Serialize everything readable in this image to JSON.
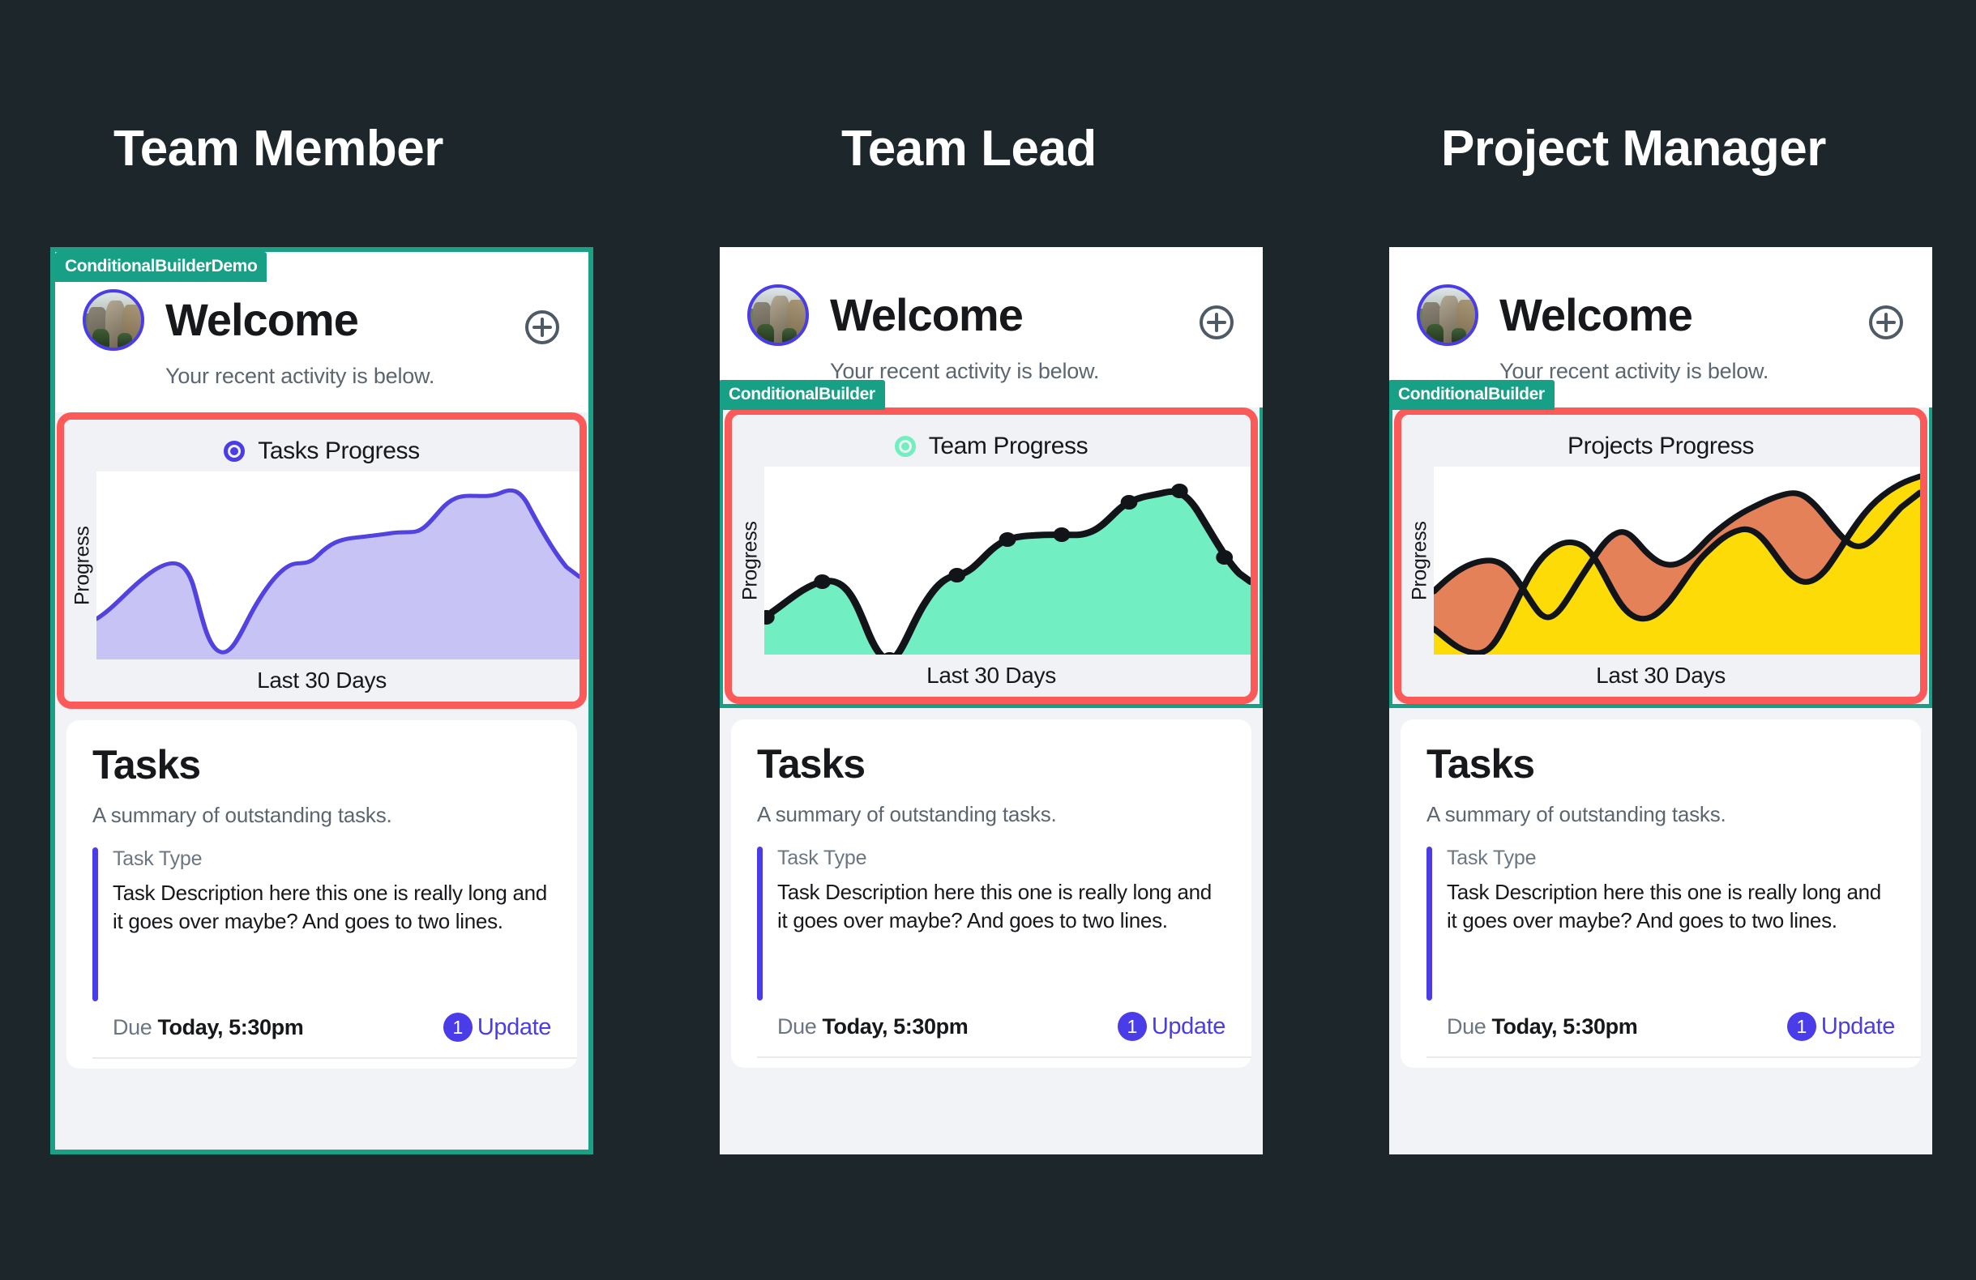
{
  "page": {
    "background_color": "#1d262b",
    "highlight_color": "#fb5a58",
    "teal_color": "#17a086",
    "accent_indigo": "#4a3ce8"
  },
  "columns": [
    {
      "heading": "Team Member",
      "builder_tag": "ConditionalBuilderDemo",
      "tag_position": "card-top",
      "card_outline": "teal-full",
      "welcome": {
        "title": "Welcome",
        "subtitle": "Your recent activity is below.",
        "avatar_icon": "avatar-photo",
        "add_icon": "plus-circle-icon"
      },
      "chart": {
        "title": "Tasks Progress",
        "has_radio": true,
        "radio_color": "#4a3ce8",
        "ylabel": "Progress",
        "xlabel": "Last 30 Days"
      },
      "tasks": {
        "title": "Tasks",
        "subtitle": "A summary of outstanding tasks.",
        "item": {
          "type": "Task Type",
          "description": "Task Description here this one is really long and it goes over maybe? And goes to two lines.",
          "due_label": "Due",
          "due_value": "Today, 5:30pm",
          "badge_count": "1",
          "update_label": "Update"
        }
      }
    },
    {
      "heading": "Team Lead",
      "builder_tag": "ConditionalBuilder",
      "tag_position": "chart-top",
      "card_outline": "teal-chart",
      "welcome": {
        "title": "Welcome",
        "subtitle": "Your recent activity is below.",
        "avatar_icon": "avatar-photo",
        "add_icon": "plus-circle-icon"
      },
      "chart": {
        "title": "Team Progress",
        "has_radio": true,
        "radio_color": "#71efc0",
        "ylabel": "Progress",
        "xlabel": "Last 30 Days"
      },
      "tasks": {
        "title": "Tasks",
        "subtitle": "A summary of outstanding tasks.",
        "item": {
          "type": "Task Type",
          "description": "Task Description here this one is really long and it goes over maybe? And goes to two lines.",
          "due_label": "Due",
          "due_value": "Today, 5:30pm",
          "badge_count": "1",
          "update_label": "Update"
        }
      }
    },
    {
      "heading": "Project Manager",
      "builder_tag": "ConditionalBuilder",
      "tag_position": "chart-top",
      "card_outline": "teal-chart",
      "welcome": {
        "title": "Welcome",
        "subtitle": "Your recent activity is below.",
        "avatar_icon": "avatar-photo",
        "add_icon": "plus-circle-icon"
      },
      "chart": {
        "title": "Projects Progress",
        "has_radio": false,
        "radio_color": "",
        "ylabel": "Progress",
        "xlabel": "Last 30 Days"
      },
      "tasks": {
        "title": "Tasks",
        "subtitle": "A summary of outstanding tasks.",
        "item": {
          "type": "Task Type",
          "description": "Task Description here this one is really long and it goes over maybe? And goes to two lines.",
          "due_label": "Due",
          "due_value": "Today, 5:30pm",
          "badge_count": "1",
          "update_label": "Update"
        }
      }
    }
  ],
  "chart_data": [
    {
      "type": "area",
      "title": "Tasks Progress",
      "xlabel": "Last 30 Days",
      "ylabel": "Progress",
      "grid": false,
      "legend": "none",
      "markers": false,
      "line_color": "#5243e0",
      "fill_color": "#c7c4f5",
      "x": [
        0,
        1,
        2,
        3,
        4,
        5,
        6,
        7,
        8,
        9,
        10,
        11,
        12,
        13
      ],
      "values": [
        22,
        40,
        46,
        2,
        30,
        52,
        56,
        72,
        74,
        76,
        86,
        90,
        96,
        56
      ],
      "ylim": [
        0,
        100
      ]
    },
    {
      "type": "area",
      "title": "Team Progress",
      "xlabel": "Last 30 Days",
      "ylabel": "Progress",
      "grid": false,
      "legend": "none",
      "markers": true,
      "line_color": "#111418",
      "fill_color": "#72efc2",
      "x": [
        0,
        1,
        2,
        3,
        4,
        5,
        6,
        7,
        8,
        9,
        10,
        11,
        12
      ],
      "values": [
        20,
        40,
        2,
        36,
        54,
        56,
        56,
        78,
        86,
        92,
        90,
        56,
        36
      ],
      "ylim": [
        0,
        100
      ]
    },
    {
      "type": "area",
      "title": "Projects Progress",
      "xlabel": "Last 30 Days",
      "ylabel": "Progress",
      "grid": false,
      "legend": "none",
      "markers": false,
      "line_color": "#111418",
      "series": [
        {
          "name": "upper",
          "fill_color": "#e48158",
          "values": [
            34,
            48,
            22,
            30,
            52,
            62,
            64,
            40,
            70,
            92,
            94,
            72,
            58,
            90
          ]
        },
        {
          "name": "lower",
          "fill_color": "#fcdb07",
          "values": [
            14,
            2,
            20,
            62,
            58,
            30,
            24,
            26,
            48,
            66,
            70,
            60,
            56,
            88
          ]
        }
      ],
      "ylim": [
        0,
        100
      ]
    }
  ]
}
